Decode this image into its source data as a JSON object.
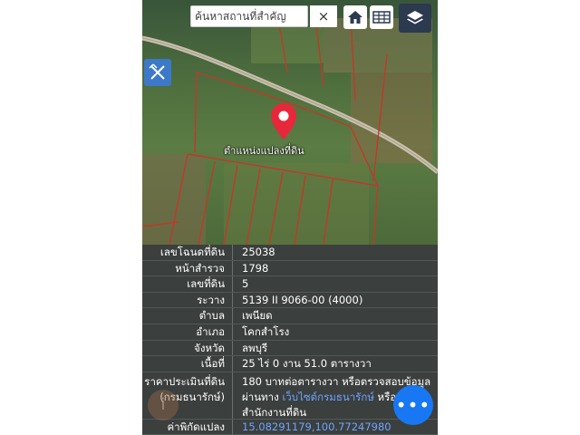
{
  "search": {
    "placeholder": "ค้นหาสถานที่สำคัญ",
    "clear_glyph": "×"
  },
  "map": {
    "marker_label": "ตำแหน่งแปลงที่ดิน",
    "marker_color": "#e8273a",
    "parcel_line_color": "#c0392b"
  },
  "info_rows": [
    {
      "label": "เลขโฉนดที่ดิน",
      "value": "25038"
    },
    {
      "label": "หน้าสำรวจ",
      "value": "1798"
    },
    {
      "label": "เลขที่ดิน",
      "value": "5"
    },
    {
      "label": "ระวาง",
      "value": "5139 II 9066-00 (4000)"
    },
    {
      "label": "ตำบล",
      "value": "เพนียด"
    },
    {
      "label": "อำเภอ",
      "value": "โคกสำโรง"
    },
    {
      "label": "จังหวัด",
      "value": "ลพบุรี"
    },
    {
      "label": "เนื้อที่",
      "value": "25 ไร่ 0 งาน 51.0 ตารางวา"
    }
  ],
  "price": {
    "label_line1": "ราคาประเมินที่ดิน",
    "label_line2": "(กรมธนารักษ์)",
    "value_line1": "180 บาทต่อตารางวา หรือตรวจสอบข้อมูล",
    "value_line2_prefix": "ผ่านทาง ",
    "value_link": "เว็บไซต์กรมธนารักษ์",
    "value_line2_suffix": " หรือติ",
    "value_line3": "สำนักงานที่ดิน"
  },
  "coords": {
    "label": "ค่าพิกัดแปลง",
    "value": "15.08291179,100.77247980"
  },
  "fab_glyph": "•••",
  "accent_color": "#1877f2"
}
